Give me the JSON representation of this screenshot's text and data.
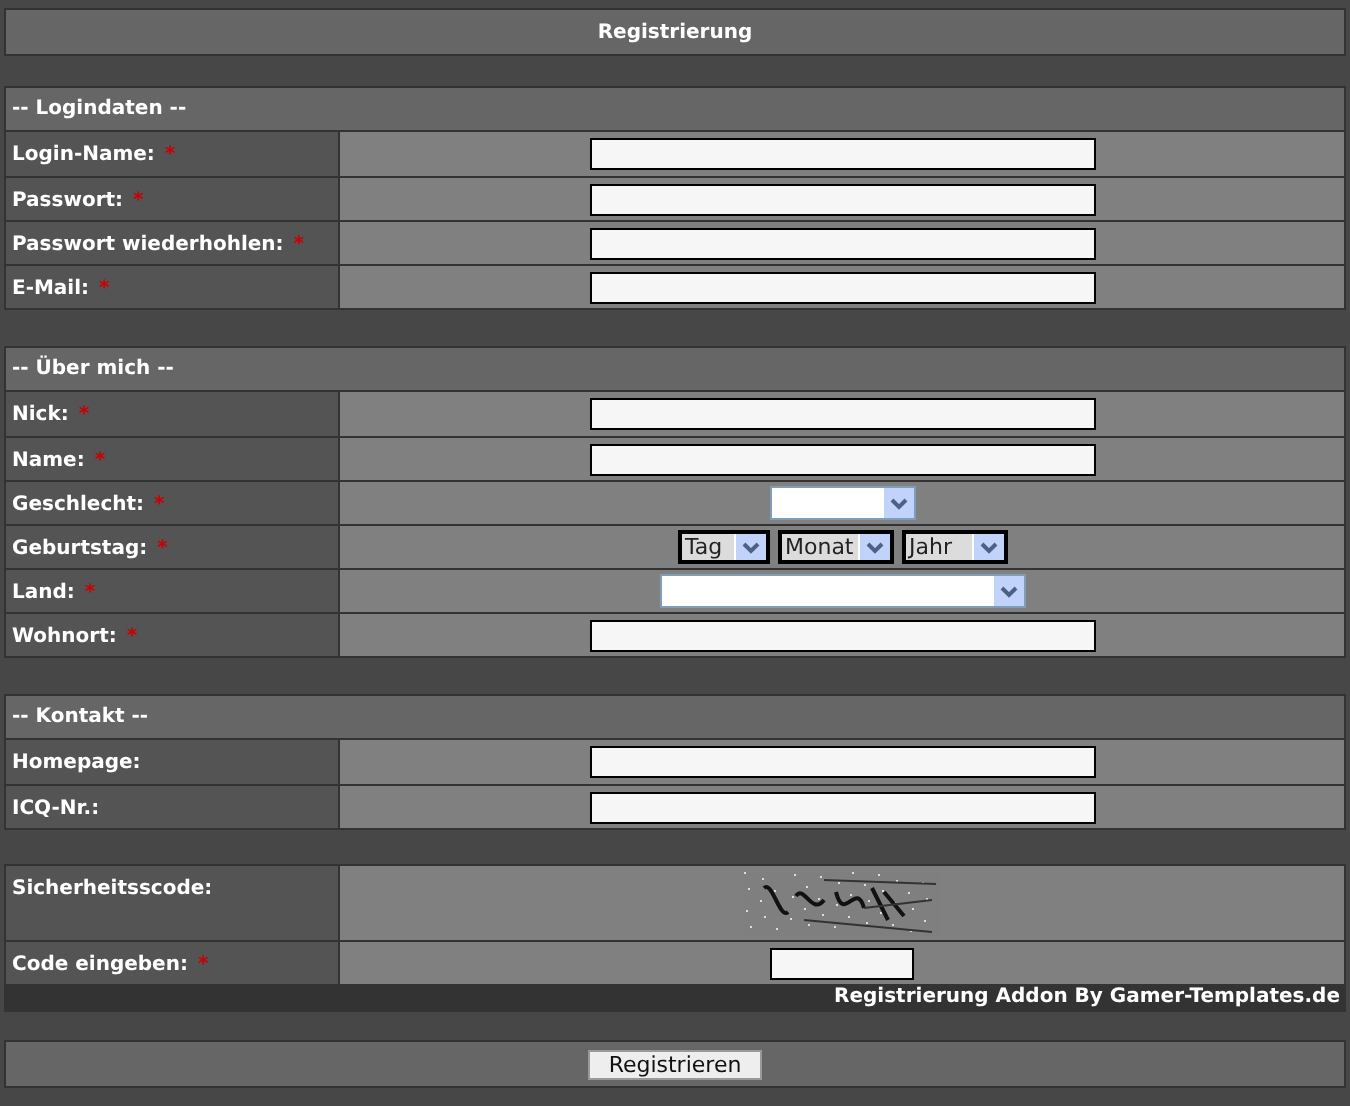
{
  "title": "Registrierung",
  "sections": [
    {
      "heading": "-- Logindaten --",
      "rows": [
        {
          "kind": "text",
          "label": "Login-Name:",
          "required": true
        },
        {
          "kind": "text",
          "label": "Passwort:",
          "required": true
        },
        {
          "kind": "text",
          "label": "Passwort wiederhohlen:",
          "required": true
        },
        {
          "kind": "text",
          "label": "E-Mail:",
          "required": true
        }
      ]
    },
    {
      "heading": "-- Über mich --",
      "rows": [
        {
          "kind": "text",
          "label": "Nick:",
          "required": true
        },
        {
          "kind": "text",
          "label": "Name:",
          "required": true
        },
        {
          "kind": "select",
          "label": "Geschlecht:",
          "required": true
        },
        {
          "kind": "date",
          "label": "Geburtstag:",
          "required": true,
          "selects": [
            "Tag",
            "Monat",
            "Jahr"
          ]
        },
        {
          "kind": "wideselect",
          "label": "Land:",
          "required": true
        },
        {
          "kind": "text",
          "label": "Wohnort:",
          "required": true
        }
      ]
    },
    {
      "heading": "-- Kontakt --",
      "rows": [
        {
          "kind": "text",
          "label": "Homepage:",
          "required": false
        },
        {
          "kind": "text",
          "label": "ICQ-Nr.:",
          "required": false
        }
      ]
    },
    {
      "rows": [
        {
          "kind": "captcha",
          "label": "Sicherheitsscode:",
          "required": false
        },
        {
          "kind": "code",
          "label": "Code eingeben:",
          "required": true
        }
      ]
    }
  ],
  "required_mark": "*",
  "credit": "Registrierung Addon By Gamer-Templates.de",
  "submit": "Registrieren"
}
